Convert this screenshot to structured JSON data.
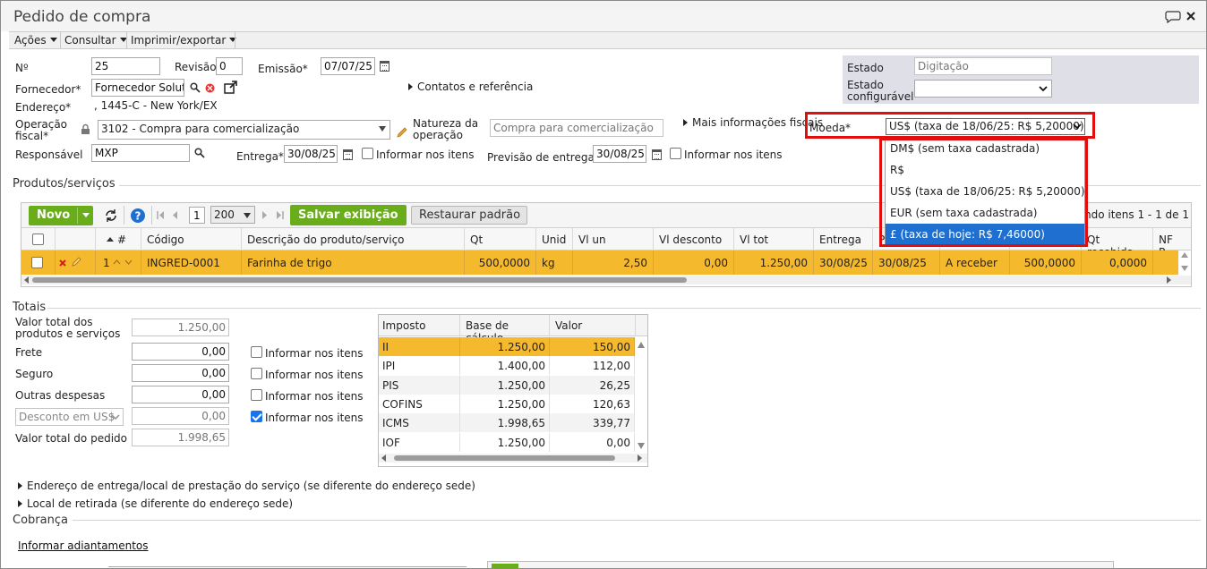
{
  "window": {
    "title": "Pedido de compra"
  },
  "menu": {
    "acoes": "Ações",
    "consultar": "Consultar",
    "imprimir": "Imprimir/exportar"
  },
  "header": {
    "numero_label": "Nº",
    "numero": "25",
    "revisao_label": "Revisão",
    "revisao": "0",
    "emissao_label": "Emissão*",
    "emissao": "07/07/25",
    "fornecedor_label": "Fornecedor*",
    "fornecedor": "Fornecedor Solutio",
    "contatos_label": "Contatos e referência",
    "endereco_label": "Endereço*",
    "endereco": ", 1445-C - New York/EX",
    "operacao_label_1": "Operação",
    "operacao_label_2": "fiscal*",
    "operacao": "3102 - Compra para comercialização",
    "natureza_label_1": "Natureza da",
    "natureza_label_2": "operação",
    "natureza": "Compra para comercialização",
    "mais_info_label": "Mais informações fiscais",
    "moeda_label": "Moeda*",
    "moeda": "US$ (taxa de 18/06/25: R$ 5,20000)",
    "responsavel_label": "Responsável",
    "responsavel": "MXP",
    "entrega_label": "Entrega*",
    "entrega": "30/08/25",
    "informar_itens": "Informar nos itens",
    "previsao_label": "Previsão de entrega*",
    "previsao": "30/08/25",
    "estado_label": "Estado",
    "estado": "Digitação",
    "estado_conf_label_1": "Estado",
    "estado_conf_label_2": "configurável",
    "estado_conf": ""
  },
  "currency_options": [
    {
      "label": "DM$ (sem taxa cadastrada)",
      "selected": false
    },
    {
      "label": "R$",
      "selected": false
    },
    {
      "label": "US$ (taxa de 18/06/25: R$ 5,20000)",
      "selected": false
    },
    {
      "label": "EUR (sem taxa cadastrada)",
      "selected": false
    },
    {
      "label": "£ (taxa de hoje: R$ 7,46000)",
      "selected": true
    }
  ],
  "produtos": {
    "section_title": "Produtos/serviços",
    "novo": "Novo",
    "page": "1",
    "page_size": "200",
    "salvar": "Salvar exibição",
    "restaurar": "Restaurar padrão",
    "range_text": "ndo itens 1 - 1 de 1",
    "columns": [
      "#",
      "Código",
      "Descrição do produto/serviço",
      "Qt",
      "Unid",
      "Vl un",
      "Vl desconto",
      "Vl tot",
      "Entrega",
      "P",
      "",
      "",
      "Qt recebida",
      "NF R"
    ],
    "row": {
      "num": "1",
      "codigo": "INGRED-0001",
      "descricao": "Farinha de trigo",
      "qt": "500,0000",
      "unid": "kg",
      "vl_un": "2,50",
      "vl_desconto": "0,00",
      "vl_tot": "1.250,00",
      "entrega": "30/08/25",
      "previsao": "30/08/25",
      "status": "A receber",
      "qt_pendente": "500,0000",
      "qt_recebida": "0,0000"
    }
  },
  "totais": {
    "section_title": "Totais",
    "valor_total_label_1": "Valor total dos",
    "valor_total_label_2": "produtos e serviços",
    "valor_total": "1.250,00",
    "frete_label": "Frete",
    "frete": "0,00",
    "seguro_label": "Seguro",
    "seguro": "0,00",
    "outras_label": "Outras despesas",
    "outras": "0,00",
    "desconto_select": "Desconto em US$",
    "desconto": "0,00",
    "pedido_label": "Valor total do pedido",
    "pedido": "1.998,65",
    "informar_frete": "Informar nos itens",
    "informar_seguro": "Informar nos itens",
    "informar_outras": "Informar nos itens",
    "informar_desconto": "Informar nos itens"
  },
  "impostos": {
    "headers": [
      "Imposto",
      "Base de cálculo",
      "Valor"
    ],
    "rows": [
      {
        "imposto": "II",
        "base": "1.250,00",
        "valor": "150,00"
      },
      {
        "imposto": "IPI",
        "base": "1.400,00",
        "valor": "112,00"
      },
      {
        "imposto": "PIS",
        "base": "1.250,00",
        "valor": "26,25"
      },
      {
        "imposto": "COFINS",
        "base": "1.250,00",
        "valor": "120,63"
      },
      {
        "imposto": "ICMS",
        "base": "1.998,65",
        "valor": "339,77"
      },
      {
        "imposto": "IOF",
        "base": "1.250,00",
        "valor": "0,00"
      }
    ]
  },
  "footer": {
    "endereco_entrega": "Endereço de entrega/local de prestação do serviço (se diferente do endereço sede)",
    "local_retirada": "Local de retirada (se diferente do endereço sede)",
    "cobranca": "Cobrança",
    "adiantamentos": "Informar adiantamentos"
  },
  "colors": {
    "highlight_row": "#f5b92e",
    "green_button": "#6aad1b",
    "selection_blue": "#1f6fd0",
    "callout_red": "#e20e0e"
  }
}
